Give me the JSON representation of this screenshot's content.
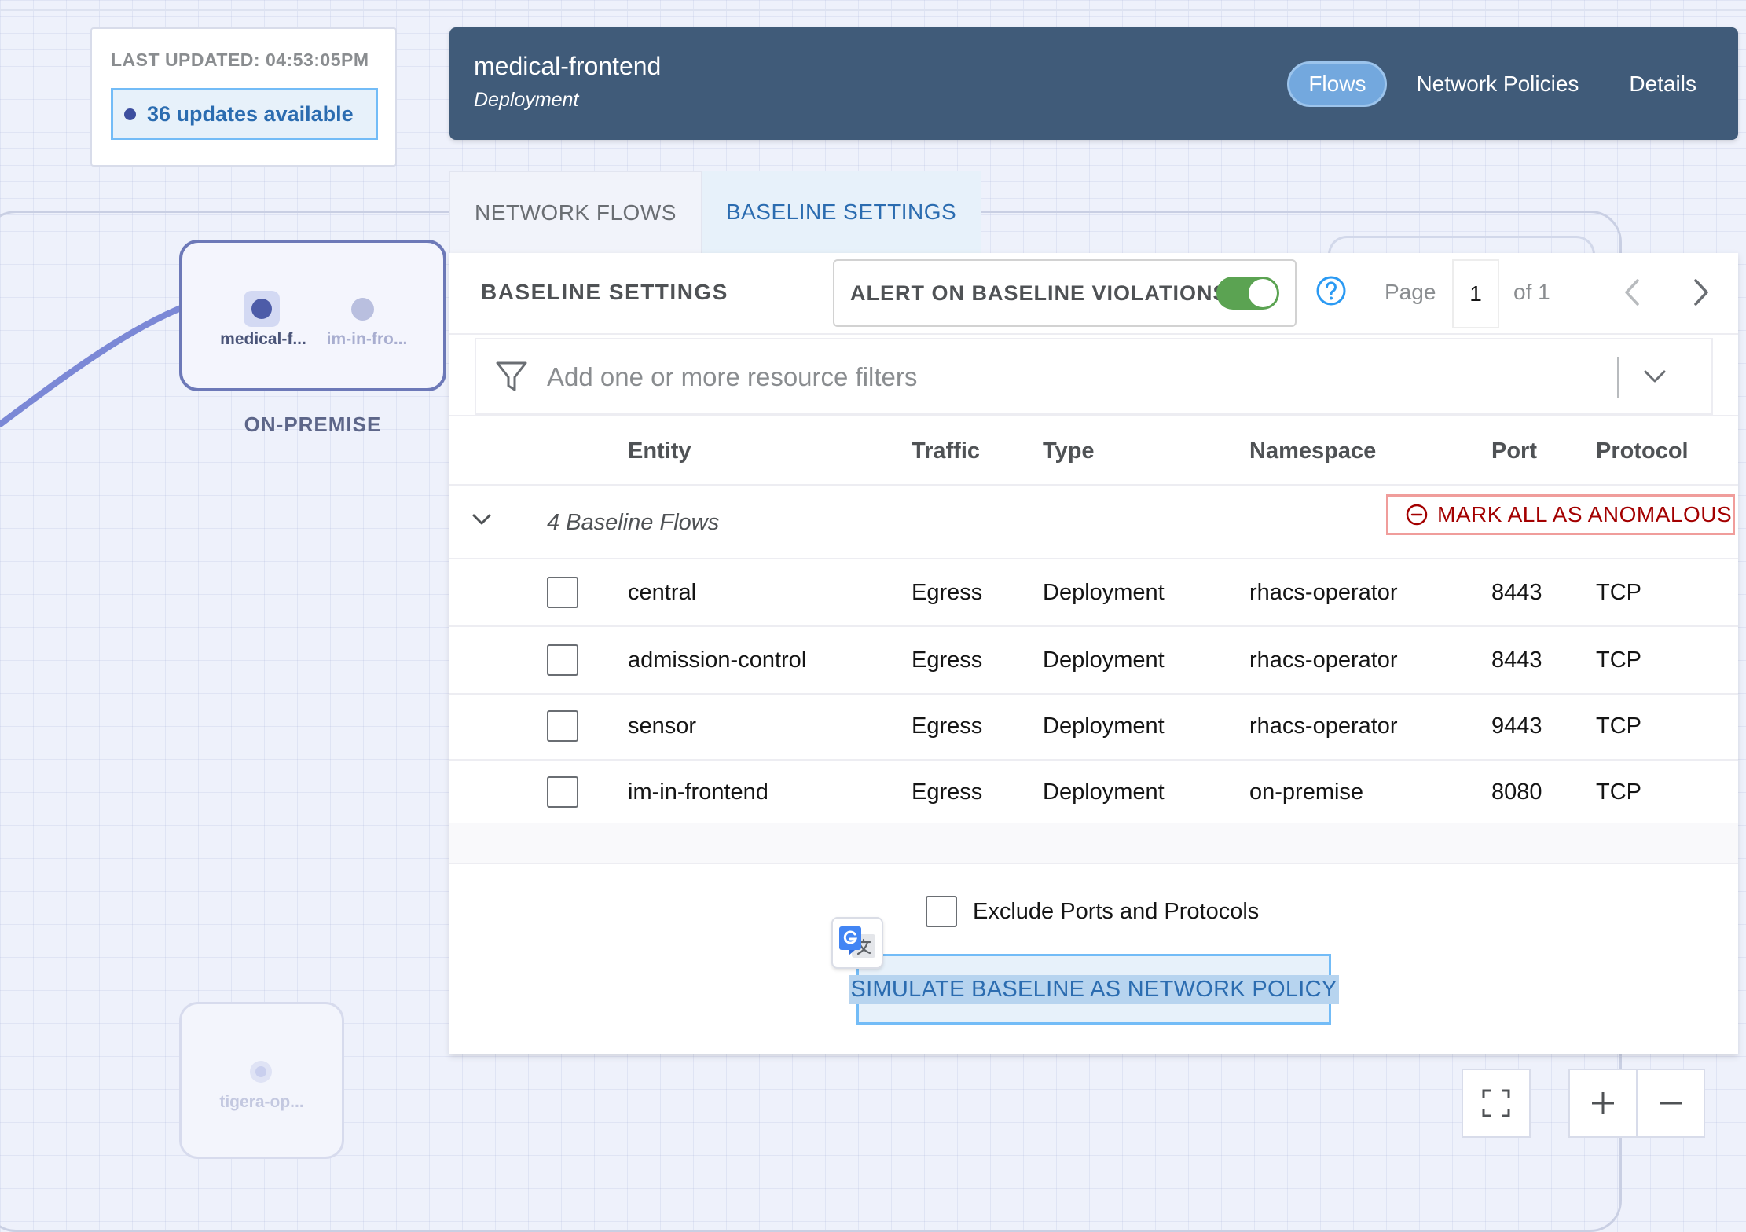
{
  "graph": {
    "last_updated": "LAST UPDATED: 04:53:05PM",
    "updates_available": "36 updates available",
    "namespace_label": "ON-PREMISE",
    "nodes": [
      {
        "label": "medical-f..."
      },
      {
        "label": "im-in-fro..."
      },
      {
        "label": "tigera-op..."
      }
    ]
  },
  "panel": {
    "title": "medical-frontend",
    "subtitle": "Deployment",
    "header_tabs": [
      "Flows",
      "Network Policies",
      "Details"
    ],
    "active_header_tab": "Flows",
    "sub_tabs": [
      "NETWORK FLOWS",
      "BASELINE SETTINGS"
    ],
    "active_sub_tab": "BASELINE SETTINGS"
  },
  "baseline": {
    "section_title": "BASELINE SETTINGS",
    "alert_label": "ALERT ON BASELINE VIOLATIONS",
    "alert_enabled": true,
    "page_label": "Page",
    "page_value": "1",
    "page_of": "of 1",
    "filter_placeholder": "Add one or more resource filters",
    "columns": [
      "Entity",
      "Traffic",
      "Type",
      "Namespace",
      "Port",
      "Protocol"
    ],
    "group_label": "4 Baseline Flows",
    "mark_all_label": "MARK ALL AS ANOMALOUS",
    "rows": [
      {
        "entity": "central",
        "traffic": "Egress",
        "type": "Deployment",
        "namespace": "rhacs-operator",
        "port": "8443",
        "protocol": "TCP"
      },
      {
        "entity": "admission-control",
        "traffic": "Egress",
        "type": "Deployment",
        "namespace": "rhacs-operator",
        "port": "8443",
        "protocol": "TCP"
      },
      {
        "entity": "sensor",
        "traffic": "Egress",
        "type": "Deployment",
        "namespace": "rhacs-operator",
        "port": "9443",
        "protocol": "TCP"
      },
      {
        "entity": "im-in-frontend",
        "traffic": "Egress",
        "type": "Deployment",
        "namespace": "on-premise",
        "port": "8080",
        "protocol": "TCP"
      }
    ],
    "exclude_label": "Exclude Ports and Protocols",
    "simulate_label": "SIMULATE BASELINE AS NETWORK POLICY"
  },
  "colors": {
    "header_bg": "#405b79",
    "accent_blue": "#2b6cb0",
    "toggle_on": "#5ba352",
    "danger": "#a30000"
  }
}
